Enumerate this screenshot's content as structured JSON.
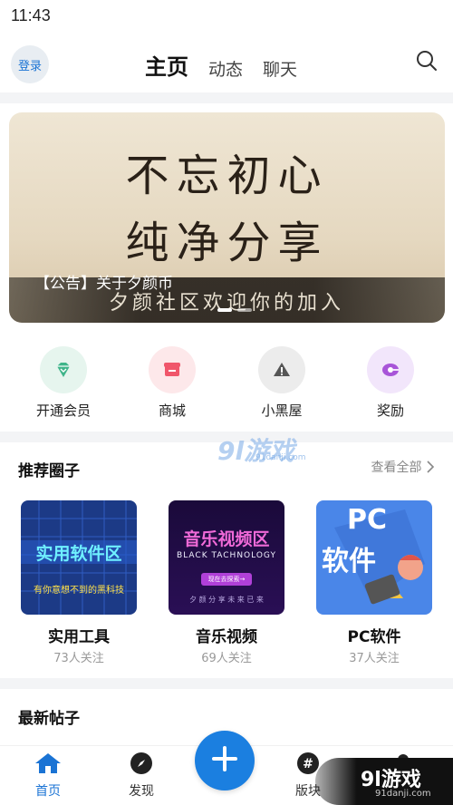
{
  "status_bar": {
    "time": "11:43"
  },
  "header": {
    "login_label": "登录",
    "tabs": [
      {
        "label": "主页",
        "active": true
      },
      {
        "label": "动态",
        "active": false
      },
      {
        "label": "聊天",
        "active": false
      }
    ],
    "search_icon": "search-icon"
  },
  "banner": {
    "line1": "不忘初心",
    "line2": "纯净分享",
    "subtext": "夕颜社区欢迎你的加入",
    "caption": "【公告】关于夕颜币",
    "dots": 2,
    "active_dot": 1
  },
  "quick_actions": [
    {
      "label": "开通会员",
      "icon": "diamond-icon",
      "color": "#3fb58a",
      "bg": "#e6f5ee"
    },
    {
      "label": "商城",
      "icon": "shop-icon",
      "color": "#f0566b",
      "bg": "#fde8ea"
    },
    {
      "label": "小黑屋",
      "icon": "warning-icon",
      "color": "#555555",
      "bg": "#ececec"
    },
    {
      "label": "奖励",
      "icon": "reward-icon",
      "color": "#a855d8",
      "bg": "#f2e6fb"
    }
  ],
  "recommended": {
    "title": "推荐圈子",
    "see_all": "查看全部",
    "circles": [
      {
        "name": "实用工具",
        "followers": "73人关注",
        "art_title": "实用软件区",
        "art_sub": "有你意想不到的黑科技"
      },
      {
        "name": "音乐视频",
        "followers": "69人关注",
        "art_title": "音乐视频区",
        "art_sub": "BLACK TACHNOLOGY",
        "art_button": "现在去探索→",
        "art_footer": "夕 颜 分 享   未 来 已 来"
      },
      {
        "name": "PC软件",
        "followers": "37人关注",
        "art_title": "PC",
        "art_sub": "软件"
      }
    ]
  },
  "latest_posts": {
    "title": "最新帖子"
  },
  "bottom_nav": {
    "items": [
      {
        "label": "首页",
        "icon": "home-icon",
        "active": true
      },
      {
        "label": "发现",
        "icon": "compass-icon",
        "active": false
      },
      {
        "label": "版块",
        "icon": "hash-icon",
        "active": false
      },
      {
        "label": "",
        "icon": "profile-icon",
        "active": false
      }
    ],
    "fab_icon": "plus-icon"
  },
  "watermark": {
    "text": "9l游戏",
    "url": "91danji.com",
    "mid_text": "9l游戏",
    "mid_url": "91danji.com"
  },
  "colors": {
    "accent": "#1b7fe0",
    "active_tab": "#111111",
    "muted": "#999999"
  }
}
